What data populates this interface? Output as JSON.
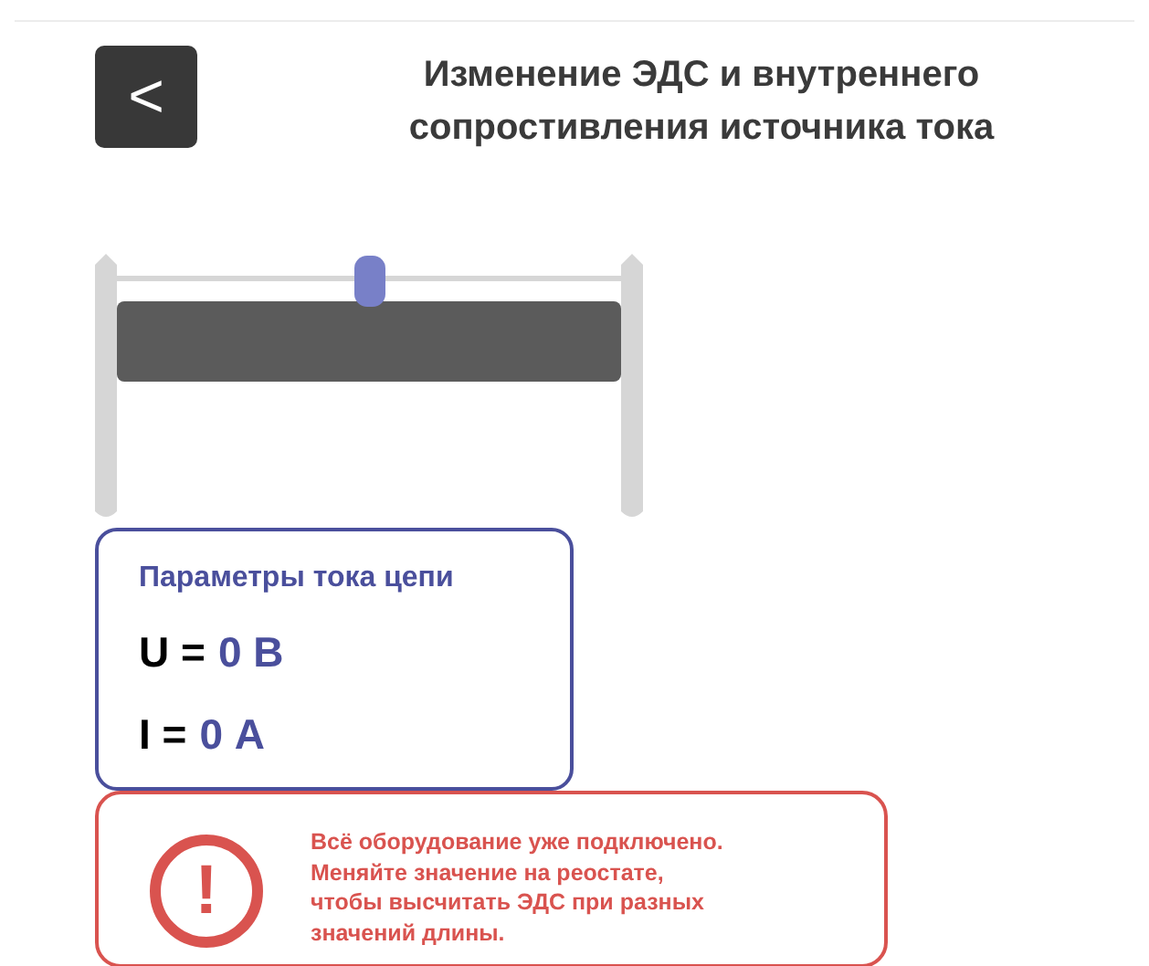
{
  "header": {
    "back_label": "<",
    "title_lines": [
      "Изменение ЭДС и внутреннего",
      "сопростивления источника тока"
    ]
  },
  "rheostat": {
    "level": 0.5
  },
  "parameters": {
    "title": "Параметры тока цепи",
    "rows": [
      {
        "symbol": "U =",
        "value": "0 В"
      },
      {
        "symbol": "I =",
        "value": "0 А"
      }
    ]
  },
  "notice": {
    "icon": "!",
    "lines": [
      "Всё оборудование уже подключено.",
      "Меняйте значение на реостате,",
      "чтобы высчитать ЭДС при разных",
      "значений длины."
    ]
  }
}
